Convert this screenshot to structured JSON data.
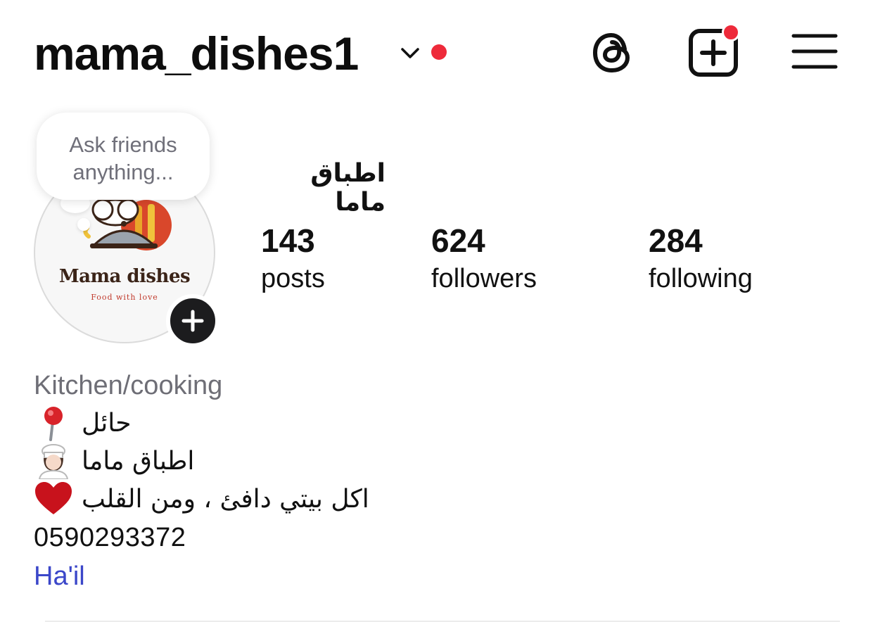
{
  "header": {
    "username": "mama_dishes1",
    "icons": {
      "account_switcher": "chevron-down-icon",
      "threads": "threads-icon",
      "create": "plus-square-icon",
      "menu": "hamburger-menu-icon"
    },
    "notification_color": "#ee2a3a"
  },
  "note": {
    "placeholder": "Ask friends anything..."
  },
  "avatar": {
    "logo_title": "Mama dishes",
    "logo_tagline": "Food with love",
    "add_story_icon": "plus-icon"
  },
  "profile": {
    "display_name": "اطباق ماما",
    "stats": [
      {
        "count": "143",
        "label": "posts"
      },
      {
        "count": "624",
        "label": "followers"
      },
      {
        "count": "284",
        "label": "following"
      }
    ]
  },
  "bio": {
    "category": "Kitchen/cooking",
    "lines": [
      {
        "text": "حائل",
        "icon": "round-pushpin-emoji"
      },
      {
        "text": "اطباق ماما",
        "icon": "woman-cook-emoji"
      },
      {
        "text": "اكل بيتي دافئ ، ومن القلب",
        "icon": "red-heart-emoji"
      }
    ],
    "phone": "0590293372",
    "location_link": "Ha'il",
    "link_color": "#3b47c9"
  }
}
